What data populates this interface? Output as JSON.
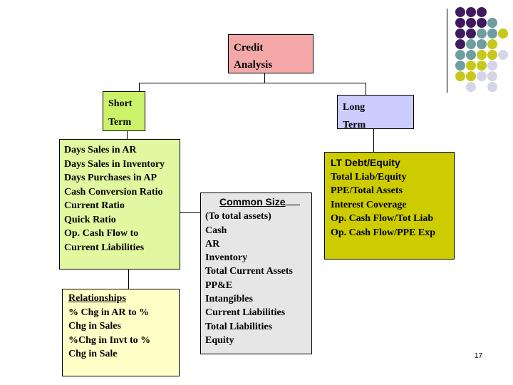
{
  "diagram": {
    "root": {
      "line1": "Credit",
      "line2": "Analysis"
    },
    "short_term": {
      "line1": "Short",
      "line2": "Term"
    },
    "long_term": {
      "line1": "Long",
      "line2": "Term"
    },
    "short_term_items": [
      "Days Sales in AR",
      "Days Sales in Inventory",
      "Days Purchases in AP",
      "Cash Conversion Ratio",
      "Current Ratio",
      "Quick Ratio",
      "Op. Cash Flow to",
      "Current Liabilities"
    ],
    "relationships": {
      "title": "Relationships",
      "items": [
        "% Chg in AR to %",
        "Chg in Sales",
        "%Chg in Invt to %",
        "Chg in Sale"
      ]
    },
    "common_size": {
      "title": "Common Size",
      "items": [
        "(To total assets)",
        "Cash",
        "AR",
        "Inventory",
        "Total Current Assets",
        "PP&E",
        "Intangibles",
        "Current Liabilities",
        "Total Liabilities",
        "Equity"
      ]
    },
    "long_term_items": [
      "LT Debt/Equity",
      "Total Liab/Equity",
      "PPE/Total Assets",
      "Interest Coverage",
      "Op. Cash Flow/Tot Liab",
      "Op. Cash Flow/PPE Exp"
    ]
  },
  "colors": {
    "root": "#f4a9a8",
    "short_term": "#ccf26a",
    "long_term": "#ccccff",
    "short_term_items": "#e2f8a0",
    "relationships": "#ffffc8",
    "common_size": "#e6e6e6",
    "long_term_items": "#cccc00",
    "dot_purple": "#3f1a5e",
    "dot_teal": "#6f9ea0",
    "dot_yellow": "#c8c81a",
    "dot_lavender": "#d5d5ea"
  },
  "page_number": "17"
}
